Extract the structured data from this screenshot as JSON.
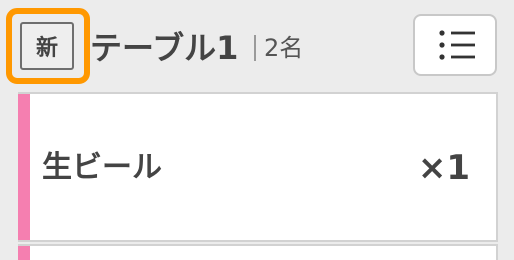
{
  "header": {
    "new_badge": "新",
    "table_name": "テーブル1",
    "guest_count": "2名",
    "menu_icon": "list-icon"
  },
  "colors": {
    "highlight": "#ff9800",
    "accent": "#f57fb0"
  },
  "order_items": [
    {
      "name": "生ビール",
      "quantity": "×1"
    }
  ]
}
